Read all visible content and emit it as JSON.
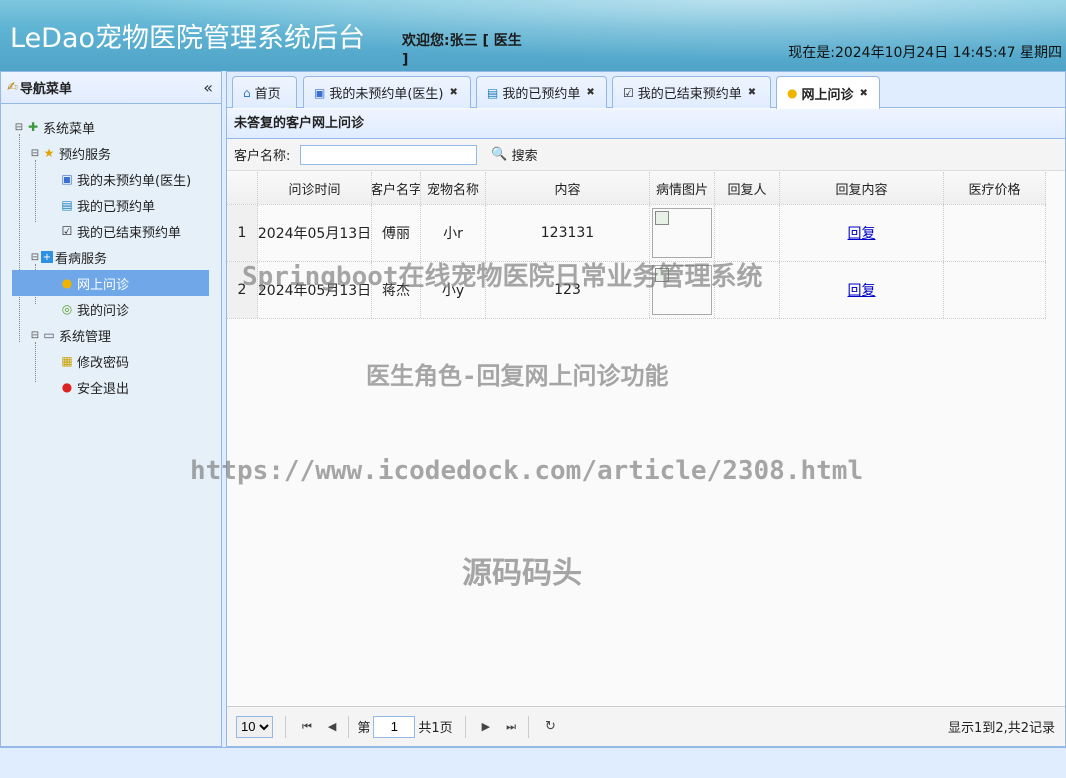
{
  "header": {
    "title": "LeDao宠物医院管理系统后台",
    "welcome": "欢迎您:张三 [ 医生 ]",
    "clock": "现在是:2024年10月24日 14:45:47 星期四"
  },
  "sidebar": {
    "title": "导航菜单",
    "collapse": "«",
    "root": "系统菜单",
    "groups": [
      {
        "label": "预约服务",
        "items": [
          "我的未预约单(医生)",
          "我的已预约单",
          "我的已结束预约单"
        ]
      },
      {
        "label": "看病服务",
        "items": [
          "网上问诊",
          "我的问诊"
        ]
      },
      {
        "label": "系统管理",
        "items": [
          "修改密码",
          "安全退出"
        ]
      }
    ],
    "selected": "网上问诊"
  },
  "tabs": [
    {
      "label": "首页",
      "closable": false
    },
    {
      "label": "我的未预约单(医生)",
      "closable": true
    },
    {
      "label": "我的已预约单",
      "closable": true
    },
    {
      "label": "我的已结束预约单",
      "closable": true
    },
    {
      "label": "网上问诊",
      "closable": true,
      "active": true
    }
  ],
  "grid": {
    "title": "未答复的客户网上问诊",
    "search_label": "客户名称:",
    "search_value": "",
    "search_button": "搜索",
    "columns": [
      "问诊时间",
      "客户名字",
      "宠物名称",
      "内容",
      "病情图片",
      "回复人",
      "回复内容",
      "医疗价格"
    ],
    "rows": [
      {
        "num": "1",
        "time": "2024年05月13日",
        "customer": "傅丽",
        "pet": "小r",
        "content": "123131",
        "replier": "",
        "reply": "回复",
        "price": ""
      },
      {
        "num": "2",
        "time": "2024年05月13日",
        "customer": "蒋杰",
        "pet": "小y",
        "content": "123",
        "replier": "",
        "reply": "回复",
        "price": ""
      }
    ]
  },
  "pager": {
    "page_size": "10",
    "page_prefix": "第",
    "page_value": "1",
    "page_suffix": "共1页",
    "info": "显示1到2,共2记录"
  },
  "watermarks": {
    "w1": "Springboot在线宠物医院日常业务管理系统",
    "w2": "医生角色-回复网上问诊功能",
    "w3": "https://www.icodedock.com/article/2308.html",
    "w4": "源码码头"
  }
}
